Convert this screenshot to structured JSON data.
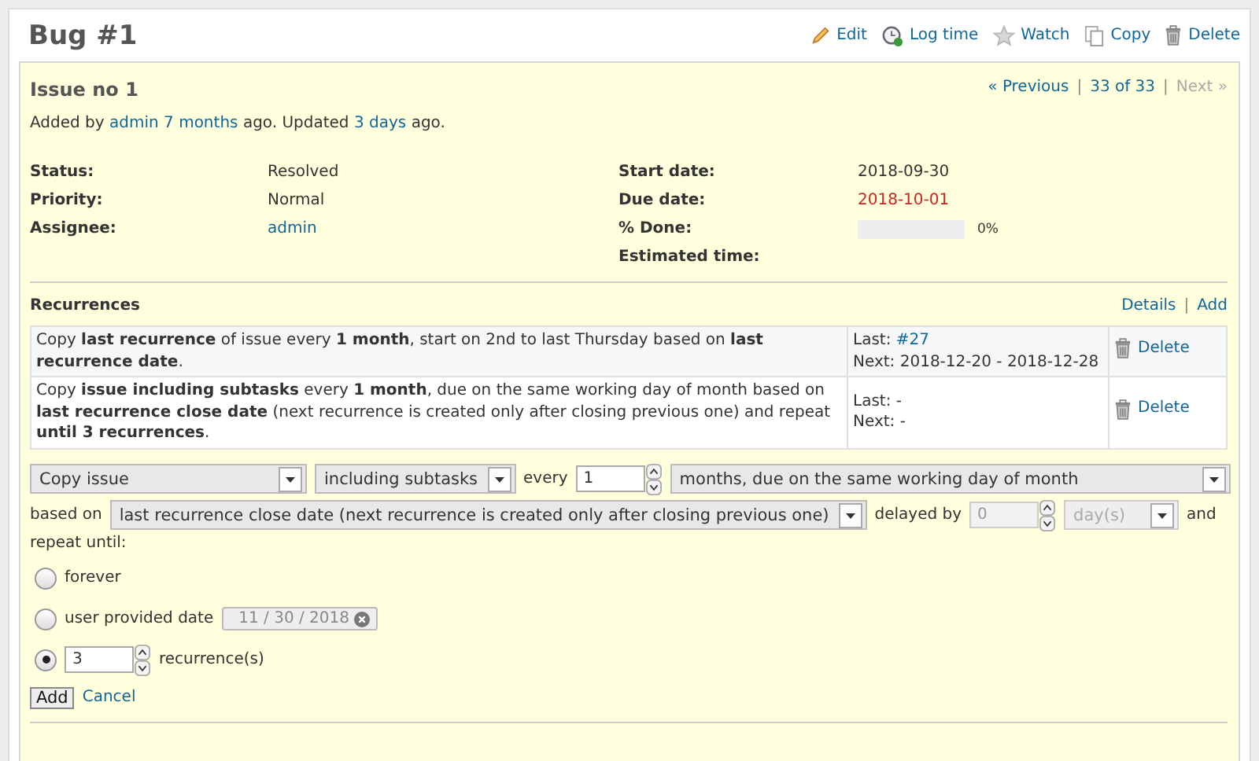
{
  "title": "Bug #1",
  "actions": [
    {
      "kind": "edit",
      "label": "Edit"
    },
    {
      "kind": "log",
      "label": "Log time"
    },
    {
      "kind": "watch",
      "label": "Watch"
    },
    {
      "kind": "copy",
      "label": "Copy"
    },
    {
      "kind": "delete",
      "label": "Delete"
    }
  ],
  "issue": {
    "subject": "Issue no 1",
    "nav": [
      {
        "kind": "link",
        "text": "« Previous"
      },
      {
        "kind": "separator",
        "text": "|"
      },
      {
        "kind": "link",
        "text": "33 of 33"
      },
      {
        "kind": "separator",
        "text": "|"
      },
      {
        "kind": "disabled",
        "text": "Next »"
      }
    ],
    "byline": {
      "prefix": "Added by",
      "author": "admin",
      "created": "7 months",
      "middle": "ago. Updated",
      "updated": "3 days",
      "suffix": "ago."
    },
    "attributes_left": [
      {
        "label": "Status:",
        "value": "Resolved",
        "kind": "text"
      },
      {
        "label": "Priority:",
        "value": "Normal",
        "kind": "text"
      },
      {
        "label": "Assignee:",
        "value": "admin",
        "kind": "link"
      }
    ],
    "attributes_right": [
      {
        "label": "Start date:",
        "value": "2018-09-30",
        "kind": "text"
      },
      {
        "label": "Due date:",
        "value": "2018-10-01",
        "kind": "overdue"
      },
      {
        "label": "% Done:",
        "value": "0%",
        "kind": "progress",
        "level": 0
      },
      {
        "label": "Estimated time:",
        "kind": "empty"
      }
    ]
  },
  "recurrences": {
    "title": "Recurrences",
    "links": [
      {
        "kind": "link",
        "text": "Details"
      },
      {
        "kind": "separator",
        "text": "|"
      },
      {
        "kind": "link",
        "text": "Add"
      }
    ],
    "rows": [
      {
        "description": "Copy **last recurrence** of issue every **1 month**, start on 2nd to last Thursday based on **last recurrence date**.",
        "last": {
          "label": "Last:",
          "value": "#27",
          "link": true
        },
        "next": {
          "label": "Next:",
          "value": "2018-12-20 - 2018-12-28"
        },
        "delete": "Delete"
      },
      {
        "description": "Copy **issue including subtasks** every **1 month**, due on the same working day of month based on **last recurrence close date** (next recurrence is created only after closing previous one) and repeat **until 3 recurrences**.",
        "last": {
          "label": "Last:",
          "value": "-",
          "link": false
        },
        "next": {
          "label": "Next:",
          "value": "-"
        },
        "delete": "Delete"
      }
    ]
  },
  "form": {
    "action": {
      "value": "Copy issue",
      "disabled": false
    },
    "subtasks": {
      "value": "including subtasks",
      "disabled": false
    },
    "every_label": "every",
    "interval": {
      "value": "1",
      "disabled": false
    },
    "unit": {
      "value": "months, due on the same working day of month",
      "disabled": false
    },
    "based_label": "based on",
    "base": {
      "value": "last recurrence close date (next recurrence is created only after closing previous one)",
      "disabled": false
    },
    "delay_label": "delayed by",
    "delay": {
      "value": "0",
      "disabled": true
    },
    "delay_unit": {
      "value": "day(s)",
      "disabled": true
    },
    "and_label": "and",
    "repeat_label": "repeat until:",
    "options": [
      {
        "kind": "forever",
        "label": "forever",
        "selected": false
      },
      {
        "kind": "date",
        "label": "user provided date",
        "value": "11 / 30 / 2018",
        "selected": false,
        "disabled": true
      },
      {
        "kind": "count",
        "value": "3",
        "suffix": "recurrence(s)",
        "selected": true,
        "disabled": false
      }
    ],
    "submit": "Add",
    "cancel": "Cancel"
  }
}
